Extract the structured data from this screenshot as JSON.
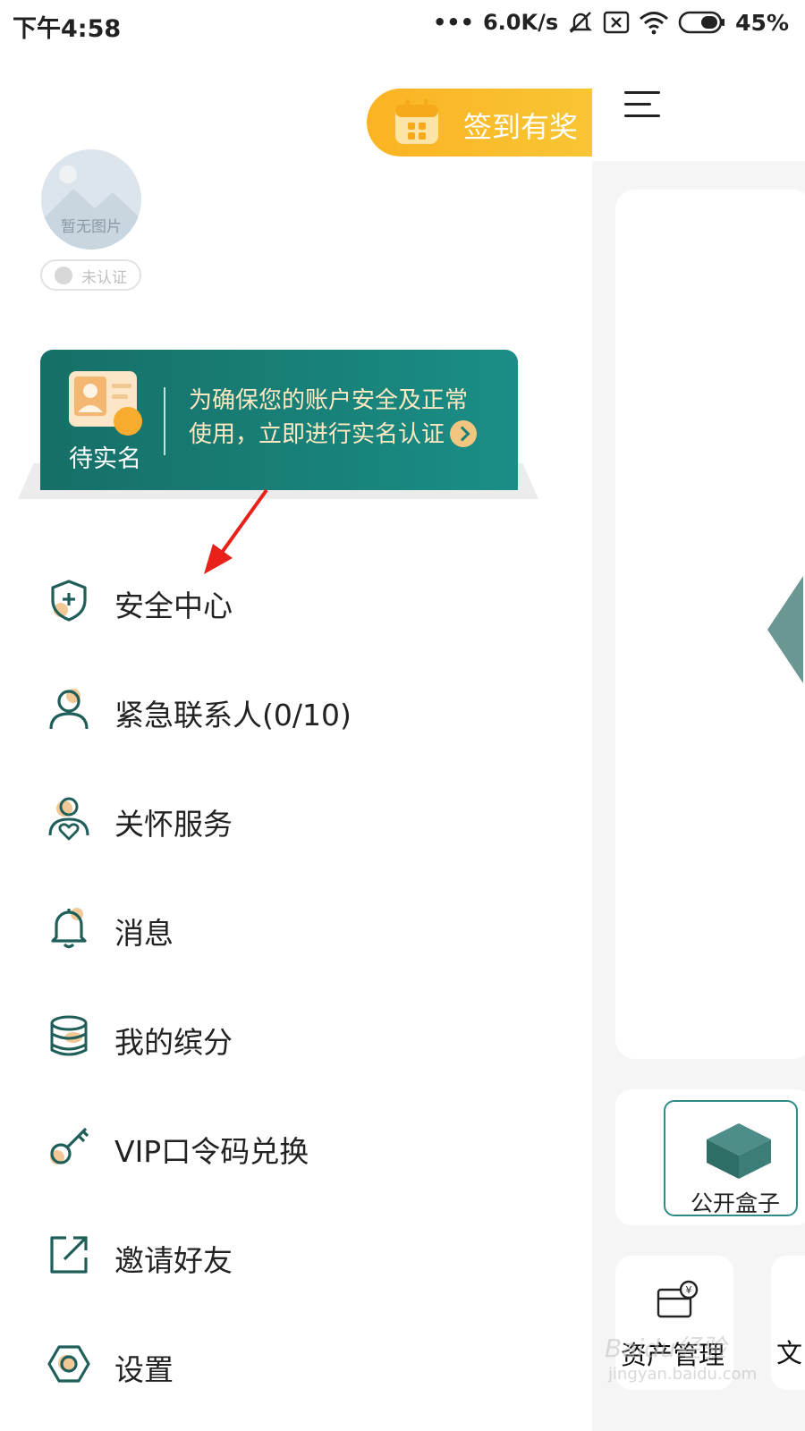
{
  "status_bar": {
    "time": "下午4:58",
    "network_speed": "6.0K/s",
    "battery": "45%"
  },
  "drawer": {
    "signin_label": "签到有奖",
    "avatar_placeholder": "暂无图片",
    "verify_status": "未认证",
    "banner": {
      "status": "待实名",
      "line1": "为确保您的账户安全及正常",
      "line2": "使用，立即进行实名认证"
    },
    "menu": [
      {
        "label": "安全中心",
        "icon": "shield-plus-icon"
      },
      {
        "label": "紧急联系人(0/10)",
        "icon": "person-icon"
      },
      {
        "label": "关怀服务",
        "icon": "care-person-heart-icon"
      },
      {
        "label": "消息",
        "icon": "bell-icon"
      },
      {
        "label": "我的缤分",
        "icon": "coin-stack-icon"
      },
      {
        "label": "VIP口令码兑换",
        "icon": "key-icon"
      },
      {
        "label": "邀请好友",
        "icon": "share-out-icon"
      },
      {
        "label": "设置",
        "icon": "hex-settings-icon"
      }
    ]
  },
  "main": {
    "public_box_label": "公开盒子",
    "asset_label": "资产管理",
    "cut_label": "文"
  },
  "watermark": {
    "line1": "Baidu经验",
    "line2": "jingyan.baidu.com"
  },
  "colors": {
    "teal": "#1a8e86",
    "accent_orange": "#fbb323",
    "icon_dark": "#1f5e59",
    "icon_peach": "#f2c896"
  }
}
